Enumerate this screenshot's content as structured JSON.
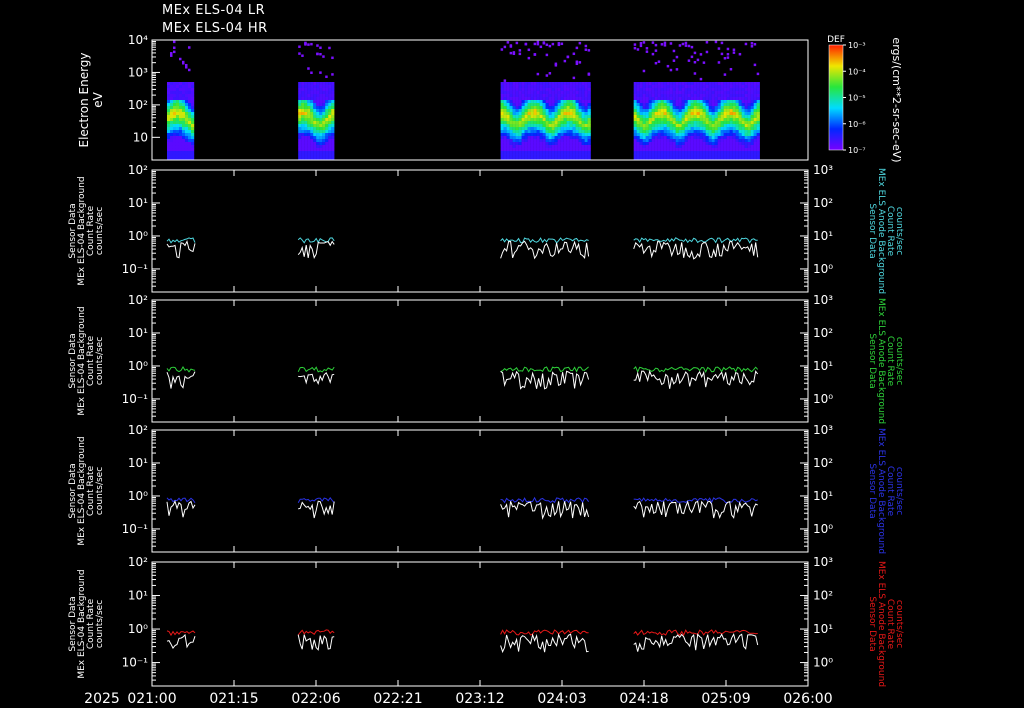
{
  "title_lines": [
    "MEx ELS-04 LR",
    "MEx ELS-04 HR"
  ],
  "x_axis": {
    "year_label": "2025",
    "tick_labels": [
      "021:00",
      "021:15",
      "022:06",
      "022:21",
      "023:12",
      "024:03",
      "024:18",
      "025:09",
      "026:00"
    ]
  },
  "colors": {
    "background": "#000000",
    "axes": "#ffffff",
    "panel1_trace": "#4fd8e0",
    "panel2_trace": "#2ed23a",
    "panel3_trace": "#2b33e8",
    "panel4_trace": "#e81818",
    "white_trace": "#ffffff"
  },
  "chart_data": [
    {
      "type": "heatmap",
      "ylabel": "Electron Energy",
      "yunit": "eV",
      "yscale": "log",
      "ylim": [
        2,
        10000
      ],
      "ytick_labels": [
        "10",
        "10²",
        "10³",
        "10⁴"
      ],
      "colorbar": {
        "label": "DEF",
        "unit": "ergs/(cm**2-sr-sec-eV)",
        "scale": "log",
        "range": [
          1e-07,
          0.001
        ],
        "tick_labels": [
          "10⁻³",
          "10⁻⁴",
          "10⁻⁵",
          "10⁻⁶",
          "10⁻⁷"
        ]
      },
      "data_intervals_x": [
        [
          0.08,
          0.23
        ],
        [
          0.78,
          0.98
        ],
        [
          1.86,
          2.34
        ],
        [
          2.57,
          3.24
        ]
      ],
      "xlim": [
        0,
        3.5
      ]
    },
    {
      "type": "line",
      "left_ylabel": [
        "Sensor Data",
        "MEx ELS-04 Background",
        "Count Rate",
        "counts/sec"
      ],
      "right_ylabel": [
        "Sensor Data",
        "MEx ELS Anode Background",
        "Count Rate",
        "counts/sec"
      ],
      "yscale": "log",
      "ylim_left": [
        0.02,
        100
      ],
      "ylim_right": [
        0.2,
        1000
      ],
      "left_tick_labels": [
        "10⁻¹",
        "10⁰",
        "10¹",
        "10²"
      ],
      "right_tick_labels": [
        "10⁰",
        "10¹",
        "10²",
        "10³"
      ],
      "series": [
        {
          "color_key": "panel1_trace",
          "level": 0.75
        },
        {
          "color_key": "white_trace",
          "level": 0.45
        }
      ]
    },
    {
      "type": "line",
      "left_ylabel": [
        "Sensor Data",
        "MEx ELS-04 Background",
        "Count Rate",
        "counts/sec"
      ],
      "right_ylabel": [
        "Sensor Data",
        "MEx ELS Anode Background",
        "Count Rate",
        "counts/sec"
      ],
      "yscale": "log",
      "ylim_left": [
        0.02,
        100
      ],
      "ylim_right": [
        0.2,
        1000
      ],
      "left_tick_labels": [
        "10⁻¹",
        "10⁰",
        "10¹",
        "10²"
      ],
      "right_tick_labels": [
        "10⁰",
        "10¹",
        "10²",
        "10³"
      ],
      "series": [
        {
          "color_key": "panel2_trace",
          "level": 0.8
        },
        {
          "color_key": "white_trace",
          "level": 0.45
        }
      ]
    },
    {
      "type": "line",
      "left_ylabel": [
        "Sensor Data",
        "MEx ELS-04 Background",
        "Count Rate",
        "counts/sec"
      ],
      "right_ylabel": [
        "Sensor Data",
        "MEx ELS Anode Background",
        "Count Rate",
        "counts/sec"
      ],
      "yscale": "log",
      "ylim_left": [
        0.02,
        100
      ],
      "ylim_right": [
        0.2,
        1000
      ],
      "left_tick_labels": [
        "10⁻¹",
        "10⁰",
        "10¹",
        "10²"
      ],
      "right_tick_labels": [
        "10⁰",
        "10¹",
        "10²",
        "10³"
      ],
      "series": [
        {
          "color_key": "panel3_trace",
          "level": 0.75
        },
        {
          "color_key": "white_trace",
          "level": 0.45
        }
      ]
    },
    {
      "type": "line",
      "left_ylabel": [
        "Sensor Data",
        "MEx ELS-04 Background",
        "Count Rate",
        "counts/sec"
      ],
      "right_ylabel": [
        "Sensor Data",
        "MEx ELS Anode Background",
        "Count Rate",
        "counts/sec"
      ],
      "yscale": "log",
      "ylim_left": [
        0.02,
        100
      ],
      "ylim_right": [
        0.2,
        1000
      ],
      "left_tick_labels": [
        "10⁻¹",
        "10⁰",
        "10¹",
        "10²"
      ],
      "right_tick_labels": [
        "10⁰",
        "10¹",
        "10²",
        "10³"
      ],
      "series": [
        {
          "color_key": "panel4_trace",
          "level": 0.8
        },
        {
          "color_key": "white_trace",
          "level": 0.45
        }
      ]
    }
  ]
}
